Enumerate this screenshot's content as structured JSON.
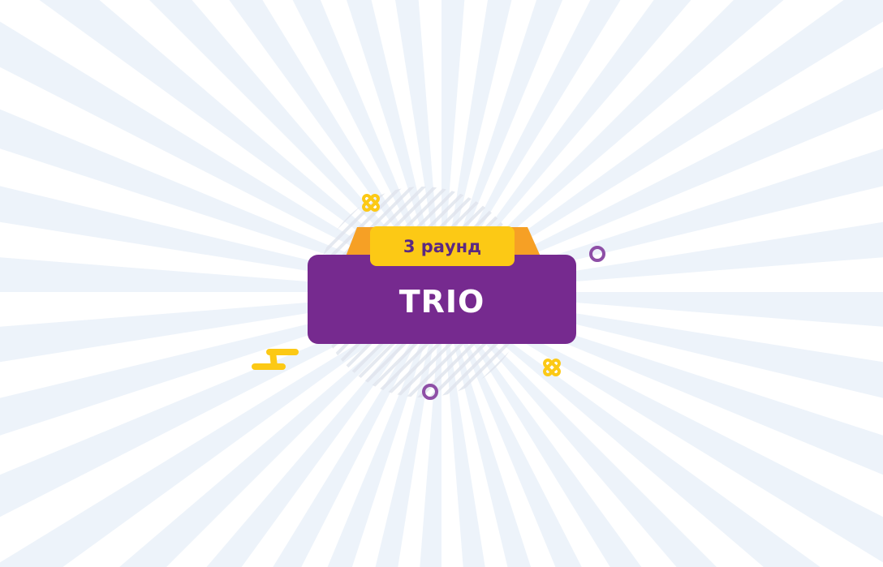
{
  "round_label": "3 раунд",
  "game_title": "TRIO",
  "colors": {
    "ray": "#edf3fa",
    "panel": "#762a8f",
    "tab": "#fcc915",
    "tab_wing": "#f6a025",
    "round_text": "#5b2882",
    "accent_purple": "#8e4fa6",
    "accent_yellow": "#fcc915"
  },
  "decorations": [
    "cross-icon",
    "cross-icon",
    "ring-icon",
    "ring-icon",
    "squiggle-icon"
  ]
}
